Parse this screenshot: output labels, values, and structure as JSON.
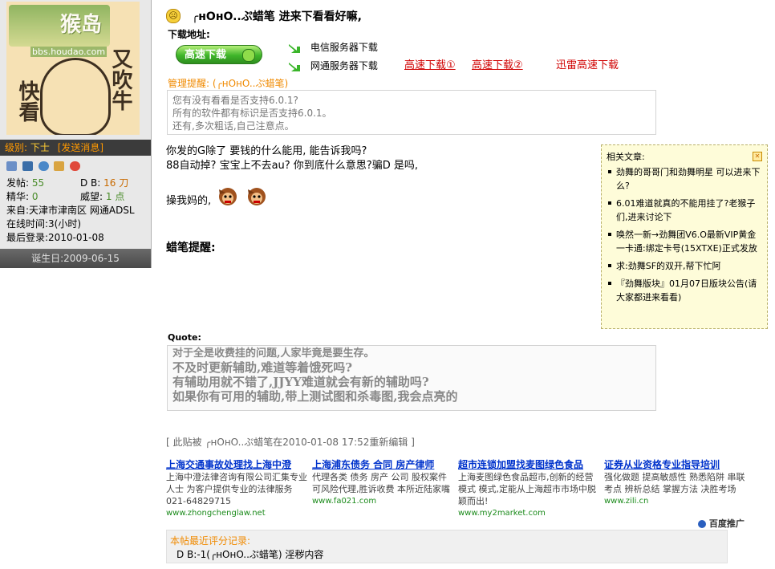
{
  "user": {
    "avatar": {
      "logo_text": "猴岛",
      "site_url": "bbs.houdao.com",
      "side_text_left": "快看",
      "side_text_right": "又吹牛"
    },
    "level_label": "级别:",
    "level_value": "下士",
    "send_message": "[发送消息]",
    "stats": {
      "posts_label": "发帖:",
      "posts_value": "55",
      "db_label": "D B:",
      "db_value": "16 刀",
      "elite_label": "精华:",
      "elite_value": "0",
      "prestige_label": "威望:",
      "prestige_value": "1 点",
      "from": "来自:天津市津南区 网通ADSL",
      "online": "在线时间:3(小时)",
      "last_login": "最后登录:2010-01-08"
    },
    "birthday": "诞生日:2009-06-15"
  },
  "post": {
    "title": "╭нOнO..ぷ蜡笔 进来下看看好嘛,",
    "download_label": "下载地址:",
    "fast_download_button": "高速下载",
    "server_links": [
      "电信服务器下载",
      "网通服务器下载"
    ],
    "red_links": [
      "高速下载①",
      "高速下载②",
      "迅雷高速下载"
    ],
    "admin_notice_label": "管理提醒: (╭нOнO..ぷ蜡笔)",
    "admin_notice_lines": [
      "您有没有看看是否支持6.0.1?",
      "所有的软件都有标识是否支持6.0.1。",
      "还有,多次粗话,自己注意点。"
    ],
    "body_lines": [
      "你发的G除了 要钱的什么能用, 能告诉我吗?",
      "88自动掉? 宝宝上不去au? 你到底什么意思?骗D 是吗,"
    ],
    "emoticon_text": "操我妈的,",
    "reminder": "蜡笔提醒:",
    "quote_label": "Quote:",
    "quote_lines": [
      "对于全是收费挂的问题,人家毕竟是要生存。",
      "不及时更新辅助,难道等着饿死吗?",
      "有辅助用就不错了,JJYY难道就会有新的辅助吗?",
      "如果你有可用的辅助,带上测试图和杀毒图,我会点亮的"
    ],
    "edit_note": "[ 此贴被 ╭нOнO..ぷ蜡笔在2010-01-08 17:52重新编辑 ]"
  },
  "related": {
    "title": "相关文章:",
    "items": [
      "劲舞的哥哥门和劲舞明星 可以进来下么?",
      "6.01难道就真的不能用挂了?老猴子们,进来讨论下",
      "唤然一新→劲舞团V6.O最新VIP黄金一卡通:绑定卡号(15XTXE)正式发放",
      "求:劲舞SF的双开,帮下忙阿",
      "『劲舞版块』01月07日版块公告(请大家都进来看看)"
    ]
  },
  "ads": [
    {
      "title": "上海交通事故处理找上海中澄",
      "desc": "上海中澄法律咨询有限公司汇集专业人士 为客户提供专业的法律服务021-64829715",
      "url": "www.zhongchenglaw.net"
    },
    {
      "title": "上海浦东债务 合同 房产律师",
      "desc": "代理各类 债务 房产 公司 股权案件 可风险代理,胜诉收费 本所近陆家嘴",
      "url": "www.fa021.com"
    },
    {
      "title": "超市连锁加盟找麦图绿色食品",
      "desc": "上海麦图绿色食品超市,创新的经营模式 模式,定能从上海超市市场中脱颖而出!",
      "url": "www.my2market.com"
    },
    {
      "title": "证券从业资格专业指导培训",
      "desc": "强化做题 提高敏感性 熟悉陷阱 串联考点 辨析总结 掌握方法 决胜考场",
      "url": "www.zili.cn"
    }
  ],
  "ad_provider": "百度推广",
  "rating": {
    "title": "本帖最近评分记录:",
    "entry": "D B:-1(╭нOнO..ぷ蜡笔) 淫秽内容"
  }
}
